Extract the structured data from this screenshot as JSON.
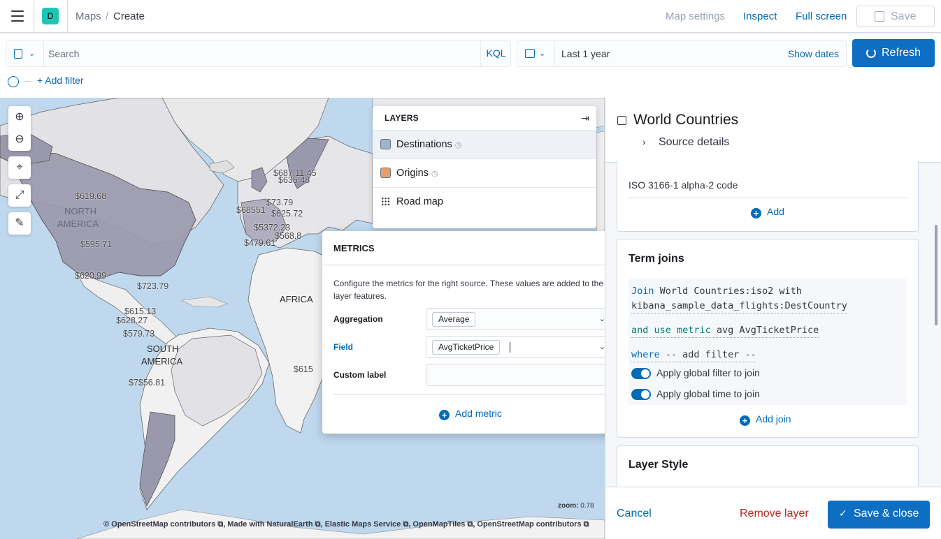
{
  "header": {
    "space_initial": "D",
    "breadcrumbs": [
      "Maps",
      "Create"
    ],
    "links": {
      "map_settings": "Map settings",
      "inspect": "Inspect",
      "full_screen": "Full screen"
    },
    "save_label": "Save"
  },
  "query": {
    "search_placeholder": "Search",
    "language": "KQL",
    "time_range": "Last 1 year",
    "show_dates": "Show dates",
    "refresh_label": "Refresh",
    "add_filter": "+ Add filter"
  },
  "map": {
    "zoom_label": "zoom:",
    "zoom_value": "0.78",
    "attribution": "© OpenStreetMap contributors ⧉, Made with NaturalEarth ⧉, Elastic Maps Service ⧉, OpenMapTiles ⧉, OpenStreetMap contributors ⧉",
    "regions": [
      "NORTH",
      "AMERICA",
      "AFRICA",
      "SOUTH",
      "AMERICA"
    ],
    "prices": [
      "$619.68",
      "$595.71",
      "$620.99",
      "$723.79",
      "$615.13",
      "$628.27",
      "$579.73",
      "$7$56.81",
      "$687.11.45",
      "$635.48",
      "$73.79",
      "$68551",
      "$625.72",
      "$5372.23",
      "$568.8",
      "$479.61",
      "$615"
    ]
  },
  "layers": {
    "title": "LAYERS",
    "items": [
      {
        "name": "Destinations",
        "color": "#a0b3cf",
        "type": "swatch",
        "clock": true
      },
      {
        "name": "Origins",
        "color": "#e7a06b",
        "type": "swatch",
        "clock": true
      },
      {
        "name": "Road map",
        "type": "tiles",
        "clock": false
      }
    ]
  },
  "metrics": {
    "title": "METRICS",
    "description": "Configure the metrics for the right source. These values are added to the layer features.",
    "aggregation_label": "Aggregation",
    "aggregation_value": "Average",
    "field_label": "Field",
    "field_value": "AvgTicketPrice",
    "custom_label_label": "Custom label",
    "custom_label_value": "",
    "add_metric": "Add metric"
  },
  "panel": {
    "title": "World Countries",
    "source_details": "Source details",
    "join_key": "ISO 3166-1 alpha-2 code",
    "add": "Add",
    "term_joins_title": "Term joins",
    "join_line1_kw": "Join",
    "join_line1_rest": " World Countries:iso2 with",
    "join_line2": "kibana_sample_data_flights:DestCountry",
    "metric_kw": "and use metric",
    "metric_rest": " avg AvgTicketPrice",
    "where_kw": "where",
    "where_rest": " -- add filter --",
    "toggle_filter": "Apply global filter to join",
    "toggle_time": "Apply global time to join",
    "add_join": "Add join",
    "layer_style_title": "Layer Style",
    "cancel": "Cancel",
    "remove_layer": "Remove layer",
    "save_close": "Save & close"
  }
}
